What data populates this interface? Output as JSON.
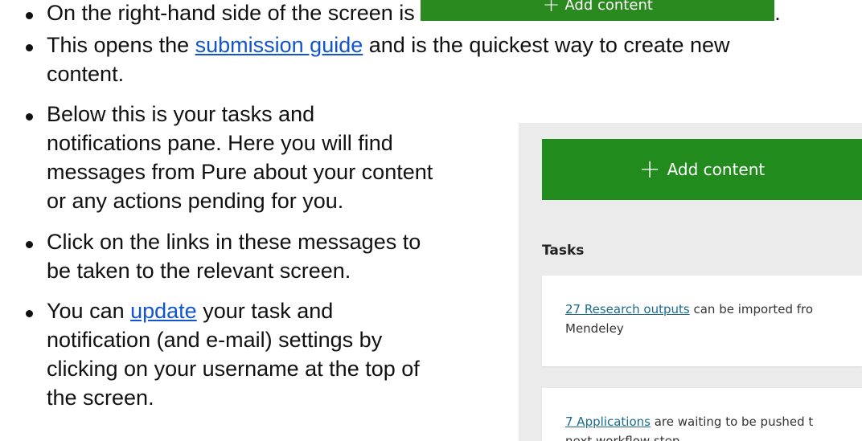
{
  "bullets": [
    {
      "lines": [
        "On the right-hand side of the screen is"
      ],
      "suffix": "."
    },
    {
      "before": "This opens the ",
      "link": "submission guide",
      "after": " and is the quickest way to create new",
      "line2": "content."
    },
    {
      "lines": [
        "Below this is your tasks and",
        "notifications pane. Here you will find",
        "messages from Pure about your content",
        "or any actions pending for you."
      ]
    },
    {
      "lines": [
        "Click on the links in these messages to",
        "be taken to the relevant screen."
      ]
    },
    {
      "before": "You can ",
      "link": "update",
      "after": " your task and",
      "lines": [
        "notification (and e-mail) settings by",
        "clicking on your username at the top of",
        "the screen."
      ]
    }
  ],
  "add_content_label": "Add content",
  "pane": {
    "add_content_label": "Add content",
    "tasks_title": "Tasks",
    "tasks": [
      {
        "link": "27 Research outputs",
        "text": " can be imported fro",
        "line2": "Mendeley"
      },
      {
        "link": "7 Applications",
        "text": " are waiting to be pushed t",
        "line2": "next workflow step"
      }
    ]
  },
  "colors": {
    "button_green": "#228b1e",
    "link_blue": "#1155cc",
    "pane_bg": "#ebebeb"
  },
  "icons": {
    "plus": "plus-icon"
  }
}
